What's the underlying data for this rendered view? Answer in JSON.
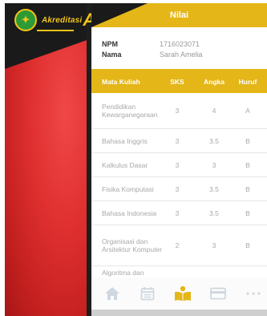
{
  "logo": {
    "text": "Akreditasi",
    "letter": "A"
  },
  "header": {
    "title": "Nilai"
  },
  "student": {
    "npm_label": "NPM",
    "npm_value": "1716023071",
    "name_label": "Nama",
    "name_value": "Sarah Amelia"
  },
  "table": {
    "headers": {
      "course": "Mata Kuliah",
      "sks": "SKS",
      "grade_value": "Angka",
      "grade_letter": "Huruf"
    },
    "rows": [
      {
        "course": "Pendidikan Kewarganegaraan",
        "sks": "3",
        "value": "4",
        "letter": "A"
      },
      {
        "course": "Bahasa Inggris",
        "sks": "3",
        "value": "3.5",
        "letter": "B"
      },
      {
        "course": "Kalkulus Dasar",
        "sks": "3",
        "value": "3",
        "letter": "B"
      },
      {
        "course": "Fisika Komputasi",
        "sks": "3",
        "value": "3.5",
        "letter": "B"
      },
      {
        "course": "Bahasa Indonesia",
        "sks": "3",
        "value": "3.5",
        "letter": "B"
      },
      {
        "course": "Organisasi dan Arsitektur Komputer",
        "sks": "2",
        "value": "3",
        "letter": "B"
      },
      {
        "course": "Algoritma dan",
        "sks": "",
        "value": "",
        "letter": ""
      }
    ]
  },
  "tabbar": {
    "items": [
      {
        "icon": "home-icon",
        "active": false
      },
      {
        "icon": "calendar-icon",
        "active": false
      },
      {
        "icon": "reader-icon",
        "active": true
      },
      {
        "icon": "card-icon",
        "active": false
      },
      {
        "icon": "more-icon",
        "active": false
      }
    ]
  },
  "colors": {
    "accent": "#e4b617",
    "dark": "#1a1a1a",
    "red": "#e03030",
    "icon_inactive": "#cfd8e0"
  }
}
